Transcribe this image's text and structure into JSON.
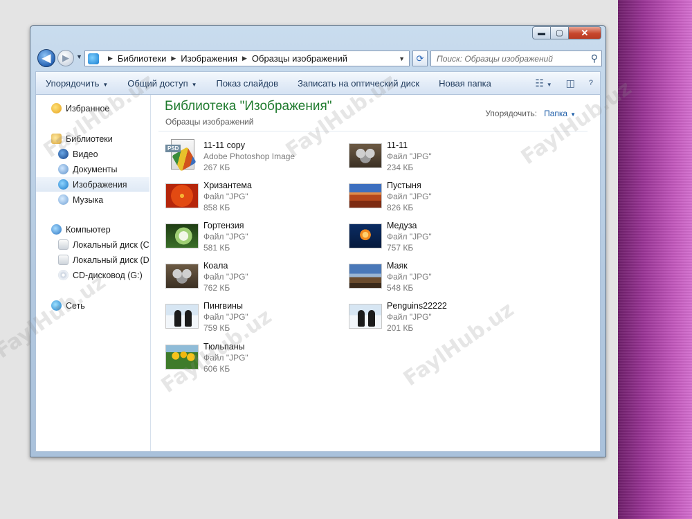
{
  "window": {
    "minimize": "▬",
    "maximize": "▢",
    "close": "✕"
  },
  "nav": {
    "back_icon": "◀",
    "forward_icon": "▶",
    "breadcrumb": [
      "Библиотеки",
      "Изображения",
      "Образцы изображений"
    ],
    "search_placeholder": "Поиск: Образцы изображений"
  },
  "toolbar": {
    "organize": "Упорядочить",
    "share": "Общий доступ",
    "slideshow": "Показ слайдов",
    "burn": "Записать на оптический диск",
    "new_folder": "Новая папка",
    "help": "?"
  },
  "sidebar": {
    "favorites": "Избранное",
    "libraries": "Библиотеки",
    "video": "Видео",
    "documents": "Документы",
    "images": "Изображения",
    "music": "Музыка",
    "computer": "Компьютер",
    "disk_c": "Локальный диск (C",
    "disk_d": "Локальный диск (D",
    "cd": "CD-дисковод (G:)",
    "network": "Сеть"
  },
  "main": {
    "title": "Библиотека \"Изображения\"",
    "subtitle": "Образцы изображений",
    "arrange_label": "Упорядочить:",
    "arrange_value": "Папка"
  },
  "files": [
    {
      "name": "11-11 copy",
      "type": "Adobe Photoshop Image",
      "size": "267 КБ",
      "thumb": "psd"
    },
    {
      "name": "11-11",
      "type": "Файл \"JPG\"",
      "size": "234 КБ",
      "thumb": "koala"
    },
    {
      "name": "Хризантема",
      "type": "Файл \"JPG\"",
      "size": "858 КБ",
      "thumb": "chrys"
    },
    {
      "name": "Пустыня",
      "type": "Файл \"JPG\"",
      "size": "826 КБ",
      "thumb": "desert"
    },
    {
      "name": "Гортензия",
      "type": "Файл \"JPG\"",
      "size": "581 КБ",
      "thumb": "hydr"
    },
    {
      "name": "Медуза",
      "type": "Файл \"JPG\"",
      "size": "757 КБ",
      "thumb": "jelly"
    },
    {
      "name": "Коала",
      "type": "Файл \"JPG\"",
      "size": "762 КБ",
      "thumb": "koala"
    },
    {
      "name": "Маяк",
      "type": "Файл \"JPG\"",
      "size": "548 КБ",
      "thumb": "light"
    },
    {
      "name": "Пингвины",
      "type": "Файл \"JPG\"",
      "size": "759 КБ",
      "thumb": "peng"
    },
    {
      "name": "Penguins22222",
      "type": "Файл \"JPG\"",
      "size": "201 КБ",
      "thumb": "peng"
    },
    {
      "name": "Тюльпаны",
      "type": "Файл \"JPG\"",
      "size": "606 КБ",
      "thumb": "tulip"
    }
  ],
  "watermark": "FaylHub.uz",
  "colors": {
    "library_title": "#1f7b2e",
    "link_blue": "#1e5ea8",
    "side_band": "#9a3596"
  }
}
